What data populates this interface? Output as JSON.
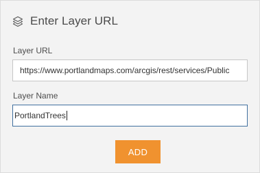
{
  "header": {
    "icon": "layers-icon",
    "title": "Enter Layer URL"
  },
  "layer_url": {
    "label": "Layer URL",
    "value": "https://www.portlandmaps.com/arcgis/rest/services/Public"
  },
  "layer_name": {
    "label": "Layer Name",
    "value": "PortlandTrees"
  },
  "add_button": {
    "label": "ADD"
  },
  "colors": {
    "panel_background": "#f3f3f3",
    "button_accent": "#f0922f",
    "focused_border": "#3f6f9e"
  }
}
